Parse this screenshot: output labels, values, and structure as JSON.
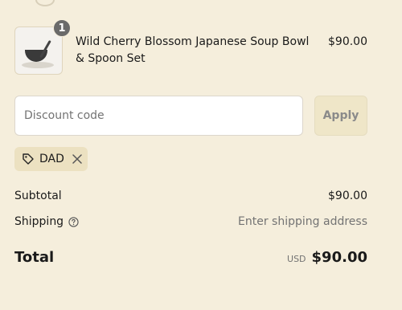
{
  "line_item": {
    "quantity": "1",
    "name": "Wild Cherry Blossom Japanese Soup Bowl & Spoon Set",
    "price": "$90.00"
  },
  "discount": {
    "placeholder": "Discount code",
    "apply_label": "Apply",
    "applied_code": "DAD"
  },
  "summary": {
    "subtotal_label": "Subtotal",
    "subtotal_value": "$90.00",
    "shipping_label": "Shipping",
    "shipping_value": "Enter shipping address",
    "total_label": "Total",
    "currency": "USD",
    "total_value": "$90.00"
  },
  "icons": {
    "tag": "tag-icon",
    "remove": "close-icon",
    "help": "help-circle-icon"
  },
  "colors": {
    "background": "#f5eedc",
    "apply_button": "#efe6c8",
    "discount_tag": "#ece1c1",
    "badge": "#6a6a6a"
  }
}
